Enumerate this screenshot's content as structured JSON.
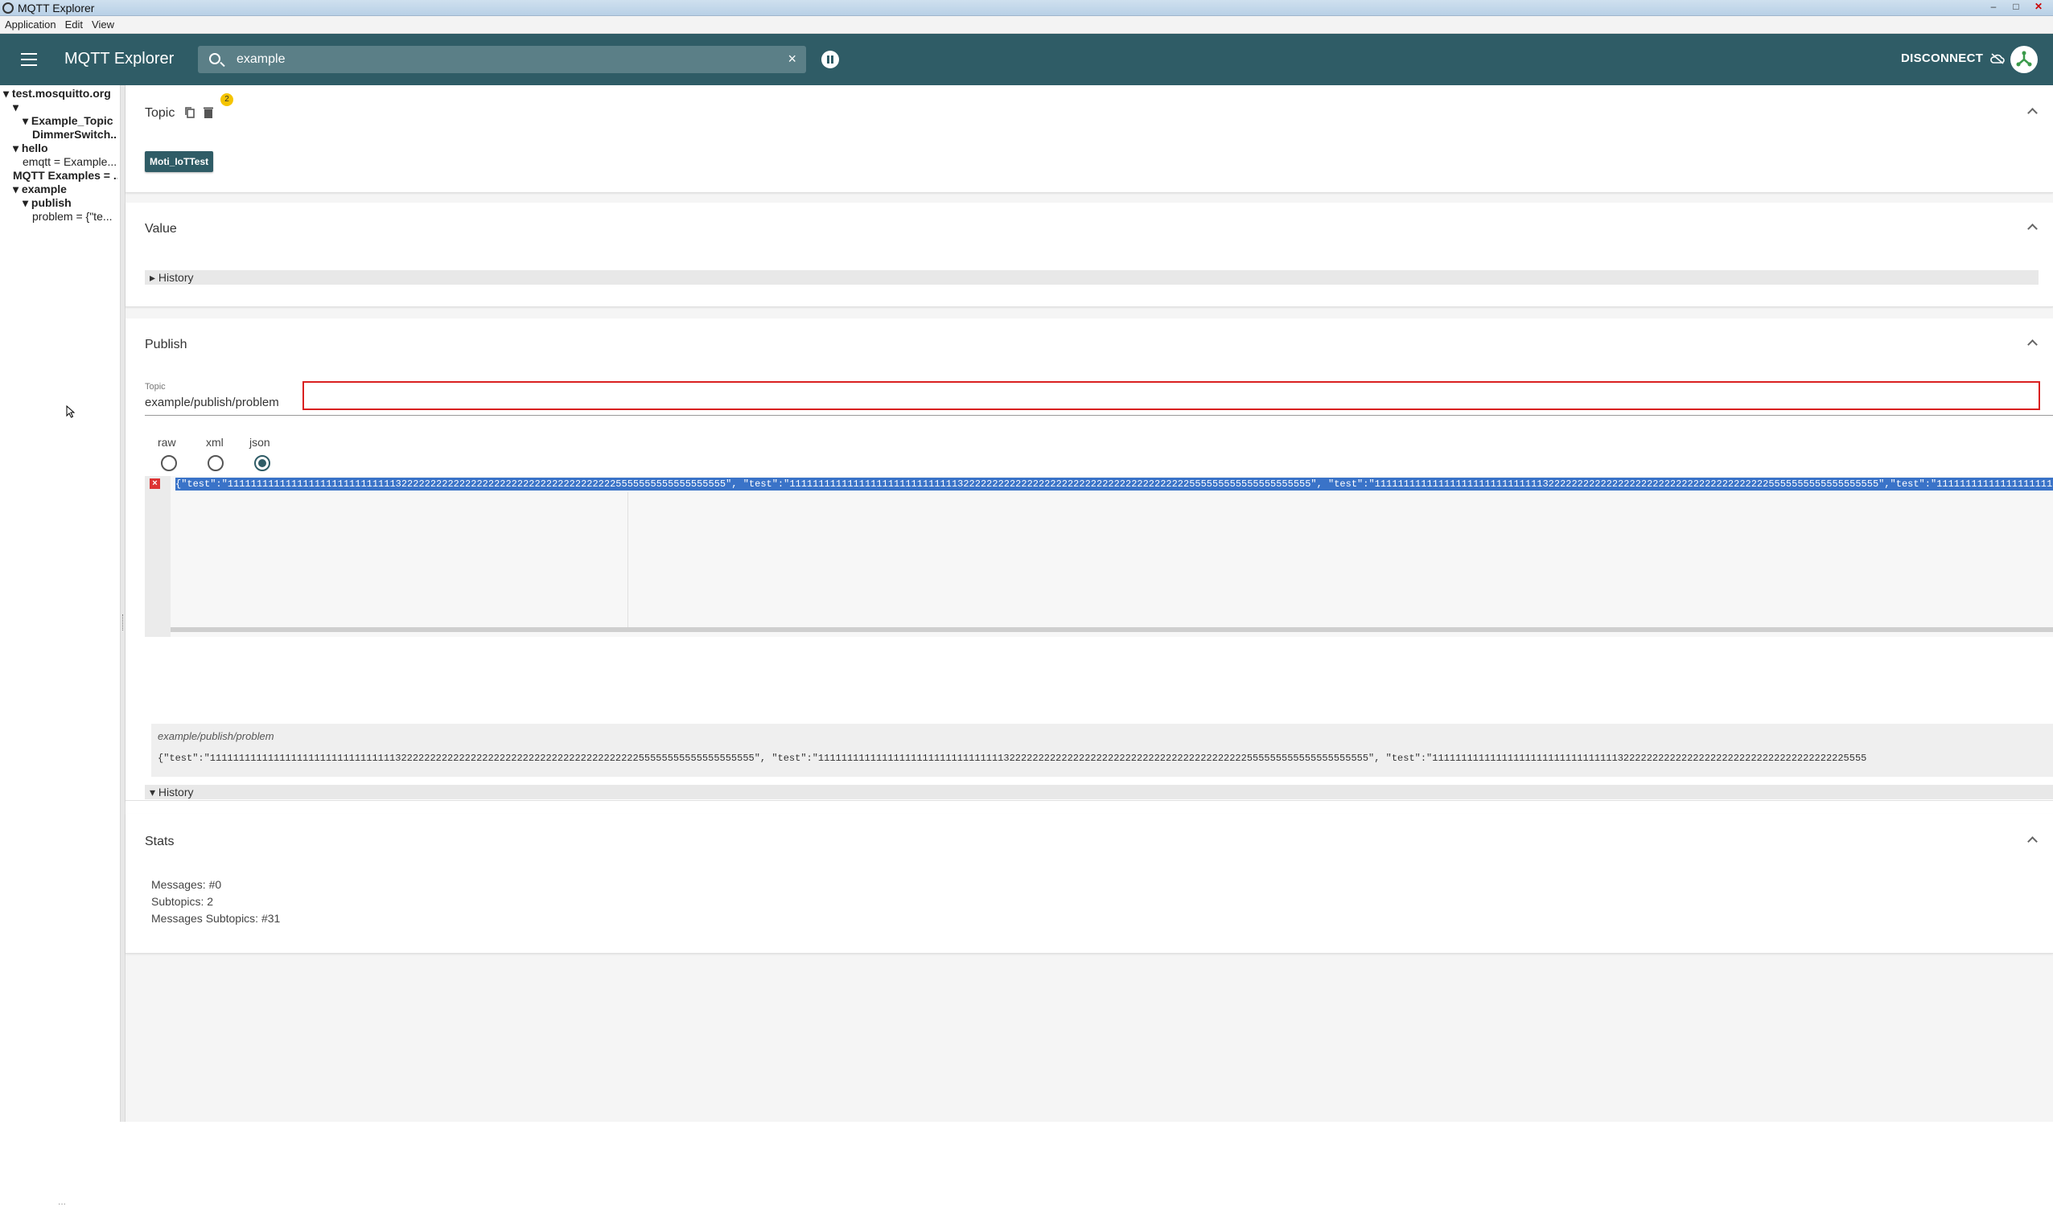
{
  "window": {
    "title": "MQTT Explorer",
    "controls": [
      "–",
      "□",
      "✕"
    ]
  },
  "menu": [
    "Application",
    "Edit",
    "View"
  ],
  "header": {
    "title": "MQTT Explorer",
    "search_value": "example",
    "disconnect_label": "DISCONNECT"
  },
  "tree": [
    {
      "text": "▾ test.mosquitto.org",
      "bold": true
    },
    {
      "text": "▾",
      "bold": true
    },
    {
      "text": "▾ Example_Topic",
      "bold": true
    },
    {
      "text": "DimmerSwitch...",
      "bold": true
    },
    {
      "text": "▾ hello",
      "bold": true
    },
    {
      "text": "emqtt = Example...",
      "bold": false
    },
    {
      "text": "MQTT Examples = ...",
      "bold": true
    },
    {
      "text": "▾ example",
      "bold": true
    },
    {
      "text": "▾ publish",
      "bold": true
    },
    {
      "text": "problem = {\"te...",
      "bold": false
    }
  ],
  "tree_footer": "...",
  "topic_card": {
    "title": "Topic",
    "badge": "2",
    "chip": "Moti_IoTTest"
  },
  "value_card": {
    "title": "Value",
    "history_label": "▸ History"
  },
  "publish_card": {
    "title": "Publish",
    "topic_label": "Topic",
    "topic_value": "example/publish/problem",
    "formats": [
      "raw",
      "xml",
      "json"
    ],
    "selected_format": "json",
    "editor_text": "{\"test\":\"11111111111111111111111111111322222222222222222222222222222222222225555555555555555555\", \"test\":\"111111111111111111111111111113222222222222222222222222222222222222222555555555555555555555\", \"test\":\"111111111111111111111111111113222222222222222222222222222222222222225555555555555555555\",\"test\":\"111111111111111111111111111111111111111",
    "history_label": "▾ History",
    "history_topic": "example/publish/problem",
    "history_value": "{\"test\":\"1111111111111111111111111111111132222222222222222222222222222222222222222255555555555555555555\", \"test\":\"11111111111111111111111111111111322222222222222222222222222222222222222222555555555555555555555\", \"test\":\"111111111111111111111111111111113222222222222222222222222222222222222225555"
  },
  "stats_card": {
    "title": "Stats",
    "messages": "Messages: #0",
    "subtopics": "Subtopics: 2",
    "messages_subtopics": "Messages Subtopics: #31"
  },
  "colors": {
    "header_bg": "#2f5c66",
    "accent": "#2f5c66",
    "badge": "#f5c400",
    "error": "#d92020",
    "selection": "#3a73c8"
  }
}
